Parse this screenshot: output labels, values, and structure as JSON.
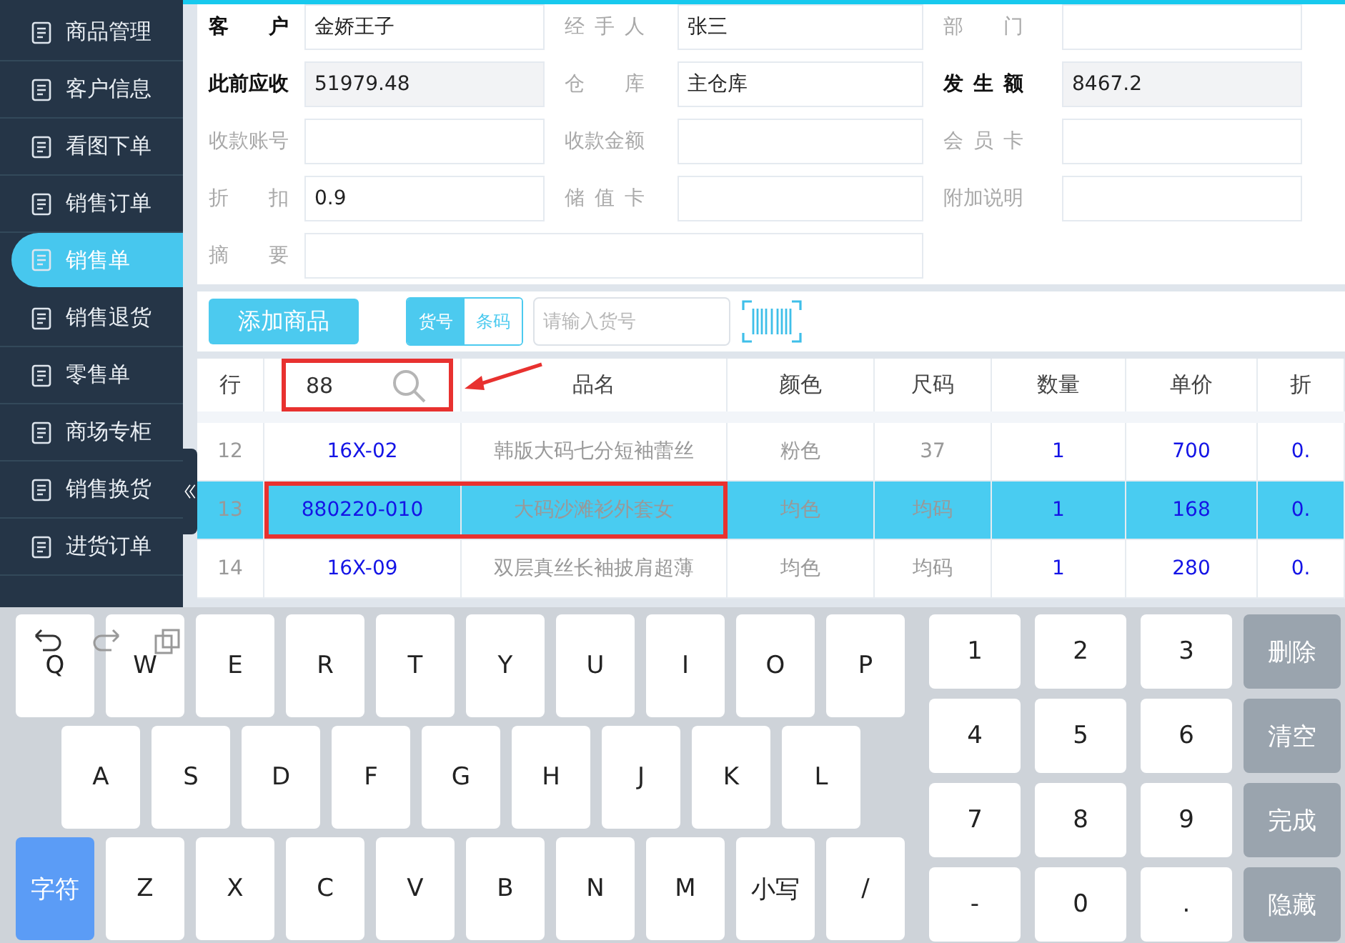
{
  "sidebar": {
    "items": [
      {
        "label": "商品管理",
        "selected": false
      },
      {
        "label": "客户信息",
        "selected": false
      },
      {
        "label": "看图下单",
        "selected": false
      },
      {
        "label": "销售订单",
        "selected": false
      },
      {
        "label": "销售单",
        "selected": true
      },
      {
        "label": "销售退货",
        "selected": false
      },
      {
        "label": "零售单",
        "selected": false
      },
      {
        "label": "商场专柜",
        "selected": false
      },
      {
        "label": "销售换货",
        "selected": false
      },
      {
        "label": "进货订单",
        "selected": false
      }
    ]
  },
  "form": {
    "fields": [
      {
        "label": "客户",
        "value": "金娇王子",
        "emphasized": true,
        "readonly": false,
        "wide": false
      },
      {
        "label": "经手人",
        "value": "张三",
        "emphasized": false,
        "readonly": false,
        "wide": false
      },
      {
        "label": "部门",
        "emphasized": false,
        "readonly": false,
        "wide": false
      },
      {
        "label": "此前应收",
        "value": "51979.48",
        "emphasized": true,
        "readonly": true,
        "wide": false
      },
      {
        "label": "仓库",
        "value": "主仓库",
        "emphasized": false,
        "readonly": false,
        "wide": false
      },
      {
        "label": "发生额",
        "value": "8467.2",
        "emphasized": true,
        "readonly": true,
        "wide": false
      },
      {
        "label": "收款账号",
        "emphasized": false,
        "readonly": false,
        "wide": false
      },
      {
        "label": "收款金额",
        "emphasized": false,
        "readonly": false,
        "wide": false
      },
      {
        "label": "会员卡",
        "emphasized": false,
        "readonly": false,
        "wide": false
      },
      {
        "label": "折扣",
        "value": "0.9",
        "emphasized": false,
        "readonly": false,
        "wide": false
      },
      {
        "label": "储值卡",
        "emphasized": false,
        "readonly": false,
        "wide": false
      },
      {
        "label": "附加说明",
        "emphasized": false,
        "readonly": false,
        "wide": false
      },
      {
        "label": "摘要",
        "emphasized": false,
        "readonly": false,
        "wide": true
      }
    ]
  },
  "toolbar": {
    "add_button": "添加商品",
    "mode_tabs": [
      {
        "label": "货号",
        "selected": true
      },
      {
        "label": "条码",
        "selected": false
      }
    ],
    "search": {
      "placeholder": "请输入货号"
    }
  },
  "table": {
    "columns": [
      {
        "kind": "text",
        "label": "行",
        "blue": false
      },
      {
        "kind": "search",
        "value": "88",
        "blue": true
      },
      {
        "kind": "text",
        "label": "品名",
        "blue": false
      },
      {
        "kind": "text",
        "label": "颜色",
        "blue": false
      },
      {
        "kind": "text",
        "label": "尺码",
        "blue": false
      },
      {
        "kind": "text",
        "label": "数量",
        "blue": true
      },
      {
        "kind": "text",
        "label": "单价",
        "blue": true
      },
      {
        "kind": "text",
        "label": "折",
        "blue": true
      }
    ],
    "rows": [
      {
        "cells": [
          "12",
          "16X-02",
          "韩版大码七分短袖蕾丝",
          "粉色",
          "37",
          "1",
          "700",
          "0."
        ],
        "selected": false,
        "highlighted": false
      },
      {
        "cells": [
          "13",
          "880220-010",
          "大码沙滩衫外套女",
          "均色",
          "均码",
          "1",
          "168",
          "0."
        ],
        "selected": true,
        "highlighted": true
      },
      {
        "cells": [
          "14",
          "16X-09",
          "双层真丝长袖披肩超薄",
          "均色",
          "均码",
          "1",
          "280",
          "0."
        ],
        "selected": false,
        "highlighted": false
      }
    ]
  },
  "keyboard": {
    "letter_rows": [
      [
        {
          "label": "Q",
          "kind": "letter"
        },
        {
          "label": "W",
          "kind": "letter"
        },
        {
          "label": "E",
          "kind": "letter"
        },
        {
          "label": "R",
          "kind": "letter"
        },
        {
          "label": "T",
          "kind": "letter"
        },
        {
          "label": "Y",
          "kind": "letter"
        },
        {
          "label": "U",
          "kind": "letter"
        },
        {
          "label": "I",
          "kind": "letter"
        },
        {
          "label": "O",
          "kind": "letter"
        },
        {
          "label": "P",
          "kind": "letter"
        }
      ],
      [
        {
          "label": "A",
          "kind": "letter"
        },
        {
          "label": "S",
          "kind": "letter"
        },
        {
          "label": "D",
          "kind": "letter"
        },
        {
          "label": "F",
          "kind": "letter"
        },
        {
          "label": "G",
          "kind": "letter"
        },
        {
          "label": "H",
          "kind": "letter"
        },
        {
          "label": "J",
          "kind": "letter"
        },
        {
          "label": "K",
          "kind": "letter"
        },
        {
          "label": "L",
          "kind": "letter"
        }
      ],
      [
        {
          "label": "字符",
          "kind": "mode"
        },
        {
          "label": "Z",
          "kind": "letter"
        },
        {
          "label": "X",
          "kind": "letter"
        },
        {
          "label": "C",
          "kind": "letter"
        },
        {
          "label": "V",
          "kind": "letter"
        },
        {
          "label": "B",
          "kind": "letter"
        },
        {
          "label": "N",
          "kind": "letter"
        },
        {
          "label": "M",
          "kind": "letter"
        },
        {
          "label": "小写",
          "kind": "letter"
        },
        {
          "label": "/",
          "kind": "letter"
        }
      ]
    ],
    "number_rows": [
      [
        {
          "label": "1",
          "kind": "digit"
        },
        {
          "label": "2",
          "kind": "digit"
        },
        {
          "label": "3",
          "kind": "digit"
        },
        {
          "label": "删除",
          "kind": "action"
        }
      ],
      [
        {
          "label": "4",
          "kind": "digit"
        },
        {
          "label": "5",
          "kind": "digit"
        },
        {
          "label": "6",
          "kind": "digit"
        },
        {
          "label": "清空",
          "kind": "action"
        }
      ],
      [
        {
          "label": "7",
          "kind": "digit"
        },
        {
          "label": "8",
          "kind": "digit"
        },
        {
          "label": "9",
          "kind": "digit"
        },
        {
          "label": "完成",
          "kind": "action"
        }
      ],
      [
        {
          "label": "-",
          "kind": "digit"
        },
        {
          "label": "0",
          "kind": "digit"
        },
        {
          "label": ".",
          "kind": "digit"
        },
        {
          "label": "隐藏",
          "kind": "action"
        }
      ]
    ]
  }
}
